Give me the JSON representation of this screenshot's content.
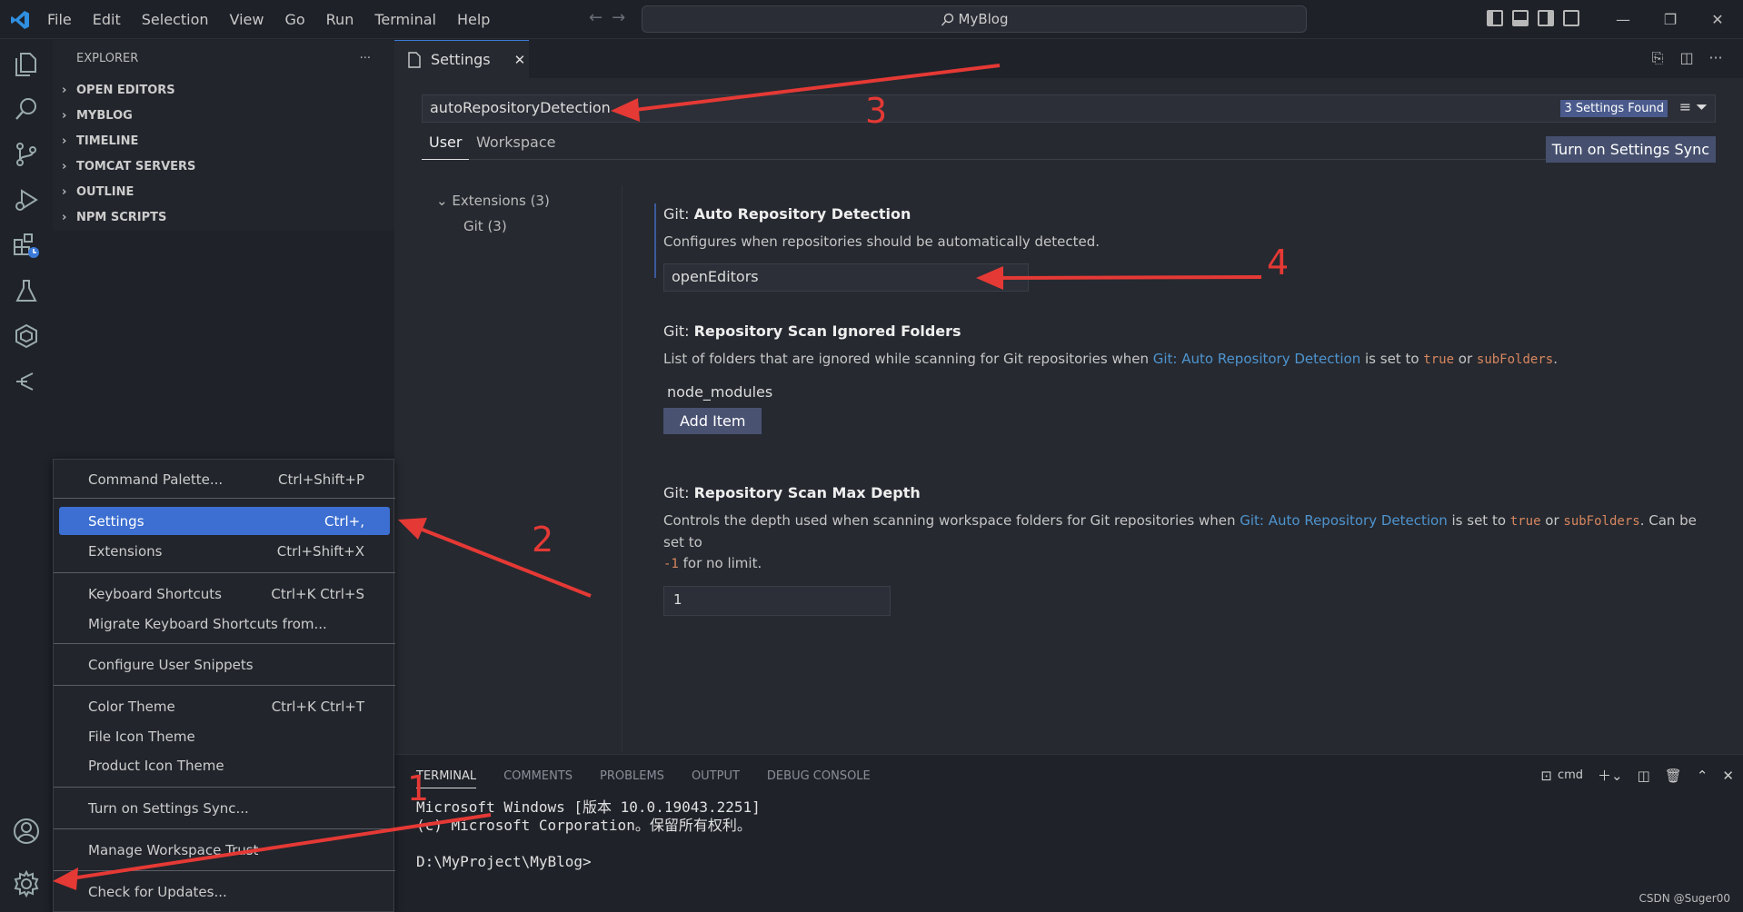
{
  "titlebar": {
    "menu": [
      "File",
      "Edit",
      "Selection",
      "View",
      "Go",
      "Run",
      "Terminal",
      "Help"
    ],
    "command_center": "MyBlog"
  },
  "sidebar": {
    "title": "EXPLORER",
    "more": "···",
    "sections": [
      "OPEN EDITORS",
      "MYBLOG",
      "TIMELINE",
      "TOMCAT SERVERS",
      "OUTLINE",
      "NPM SCRIPTS"
    ]
  },
  "tab": {
    "label": "Settings",
    "close": "✕"
  },
  "settings": {
    "search_value": "autoRepositoryDetection",
    "found_badge": "3 Settings Found",
    "tabs": [
      "User",
      "Workspace"
    ],
    "sync_button": "Turn on Settings Sync",
    "toc": [
      "Extensions (3)",
      "Git (3)"
    ],
    "items": [
      {
        "category": "Git:",
        "name": "Auto Repository Detection",
        "desc": "Configures when repositories should be automatically detected.",
        "value": "openEditors"
      },
      {
        "category": "Git:",
        "name": "Repository Scan Ignored Folders",
        "desc_pre": "List of folders that are ignored while scanning for Git repositories when ",
        "link": "Git: Auto Repository Detection",
        "desc_mid": " is set to ",
        "code1": "true",
        "desc_or": " or ",
        "code2": "subFolders",
        "desc_end": ".",
        "list_item": "node_modules",
        "add_button": "Add Item"
      },
      {
        "category": "Git:",
        "name": "Repository Scan Max Depth",
        "desc_pre": "Controls the depth used when scanning workspace folders for Git repositories when ",
        "link": "Git: Auto Repository Detection",
        "desc_mid": " is set to ",
        "code1": "true",
        "desc_or": " or ",
        "code2": "subFolders",
        "desc_end": ". Can be set to",
        "code3": "-1",
        "desc_tail": " for no limit.",
        "value": "1"
      }
    ]
  },
  "panel": {
    "tabs": [
      "TERMINAL",
      "COMMENTS",
      "PROBLEMS",
      "OUTPUT",
      "DEBUG CONSOLE"
    ],
    "shell": "cmd",
    "lines": [
      "Microsoft Windows [版本 10.0.19043.2251]",
      "(c) Microsoft Corporation。保留所有权利。",
      "",
      "D:\\MyProject\\MyBlog>"
    ]
  },
  "context_menu": [
    {
      "label": "Command Palette...",
      "shortcut": "Ctrl+Shift+P"
    },
    {
      "label": "Settings",
      "shortcut": "Ctrl+,"
    },
    {
      "label": "Extensions",
      "shortcut": "Ctrl+Shift+X"
    },
    {
      "label": "Keyboard Shortcuts",
      "shortcut": "Ctrl+K Ctrl+S"
    },
    {
      "label": "Migrate Keyboard Shortcuts from...",
      "shortcut": ""
    },
    {
      "label": "Configure User Snippets",
      "shortcut": ""
    },
    {
      "label": "Color Theme",
      "shortcut": "Ctrl+K Ctrl+T"
    },
    {
      "label": "File Icon Theme",
      "shortcut": ""
    },
    {
      "label": "Product Icon Theme",
      "shortcut": ""
    },
    {
      "label": "Turn on Settings Sync...",
      "shortcut": ""
    },
    {
      "label": "Manage Workspace Trust",
      "shortcut": ""
    },
    {
      "label": "Check for Updates...",
      "shortcut": ""
    }
  ],
  "annotations": [
    "1",
    "2",
    "3",
    "4"
  ],
  "watermark": "CSDN @Suger00",
  "colors": {
    "accent": "#3c6fd1",
    "annotation": "#e53935",
    "link": "#4e94ce"
  }
}
